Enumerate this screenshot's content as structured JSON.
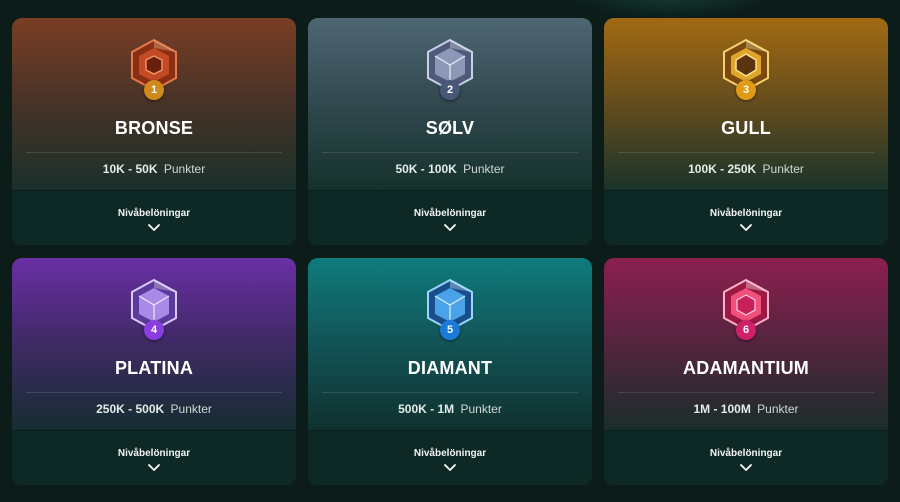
{
  "rewards_label": "Nivåbelöningar",
  "tiers": [
    {
      "level": "1",
      "name": "BRONSE",
      "range": "10K - 50K",
      "unit": "Punkter",
      "gem_color": "#c24a24",
      "num_color": "#d08a1c"
    },
    {
      "level": "2",
      "name": "SØLV",
      "range": "50K - 100K",
      "unit": "Punkter",
      "gem_color": "#8c98b8",
      "num_color": "#4a5878"
    },
    {
      "level": "3",
      "name": "GULL",
      "range": "100K - 250K",
      "unit": "Punkter",
      "gem_color": "#e0a62c",
      "num_color": "#e09a16"
    },
    {
      "level": "4",
      "name": "PLATINA",
      "range": "250K - 500K",
      "unit": "Punkter",
      "gem_color": "#a98ae6",
      "num_color": "#8a3ee0"
    },
    {
      "level": "5",
      "name": "DIAMANT",
      "range": "500K - 1M",
      "unit": "Punkter",
      "gem_color": "#4aa2e8",
      "num_color": "#1a7ad8"
    },
    {
      "level": "6",
      "name": "ADAMANTIUM",
      "range": "1M - 100M",
      "unit": "Punkter",
      "gem_color": "#f0507a",
      "num_color": "#d0206a"
    }
  ]
}
